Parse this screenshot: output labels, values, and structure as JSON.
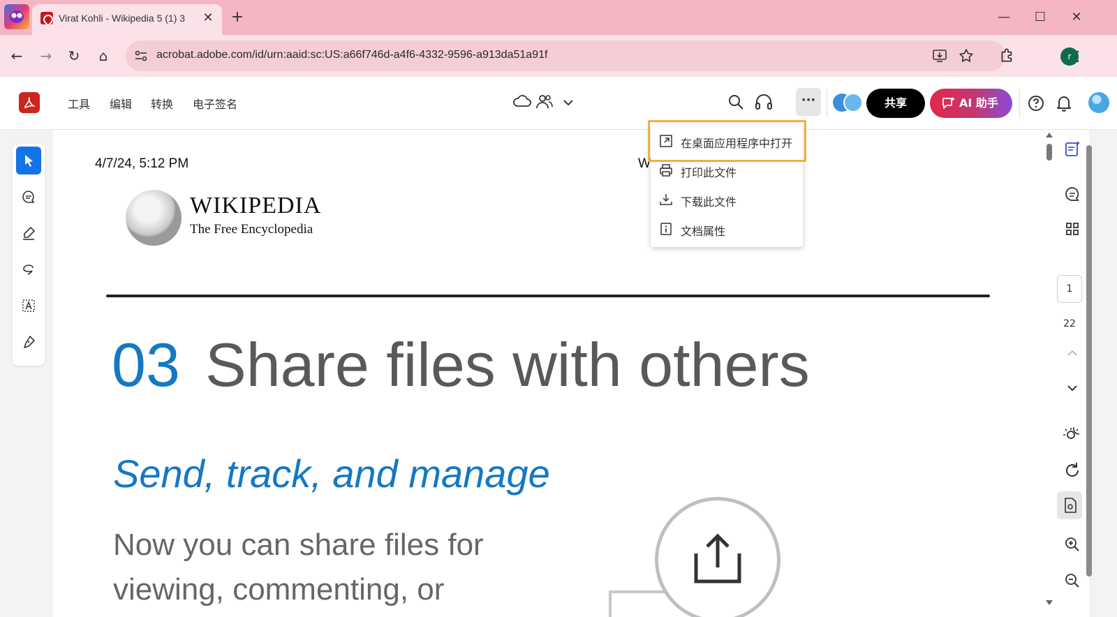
{
  "browser": {
    "tab_title": "Virat Kohli - Wikipedia 5 (1) 3",
    "tab_close": "✕",
    "new_tab": "+",
    "url": "acrobat.adobe.com/id/urn:aaid:sc:US:a66f746d-a4f6-4332-9596-a913da51a91f",
    "profile_initial": "r",
    "window_controls": {
      "minimize": "—",
      "maximize": "☐",
      "close": "✕"
    },
    "nav": {
      "back": "←",
      "forward": "→",
      "reload": "↻",
      "home": "⌂",
      "menu": "⋮"
    }
  },
  "acrobat": {
    "menu": [
      "工具",
      "编辑",
      "转换",
      "电子签名"
    ],
    "more_label": "···",
    "share_label": "共享",
    "ai_label": "AI 助手",
    "colors": {
      "share_bg": "#000000",
      "ai_gradient": [
        "#e3264a",
        "#8a4bd9"
      ],
      "select_tool": "#1473e6",
      "menu_highlight": "#f0b040"
    }
  },
  "dropdown": {
    "items": [
      {
        "label": "在桌面应用程序中打开",
        "icon": "open-external-icon"
      },
      {
        "label": "打印此文件",
        "icon": "print-icon"
      },
      {
        "label": "下载此文件",
        "icon": "download-icon"
      },
      {
        "label": "文档属性",
        "icon": "info-icon"
      }
    ]
  },
  "document": {
    "date": "4/7/24, 5:12 PM",
    "header_partial": "Wiki",
    "wordmark_title": "WIKIPEDIA",
    "wordmark_subtitle": "The Free Encyclopedia",
    "heading_number": "03",
    "heading_text": "Share files with others",
    "subheading": "Send, track, and manage",
    "body_lines": [
      "Now you can share files for",
      "viewing, commenting, or"
    ]
  },
  "page_nav": {
    "current": "1",
    "total": "22"
  }
}
